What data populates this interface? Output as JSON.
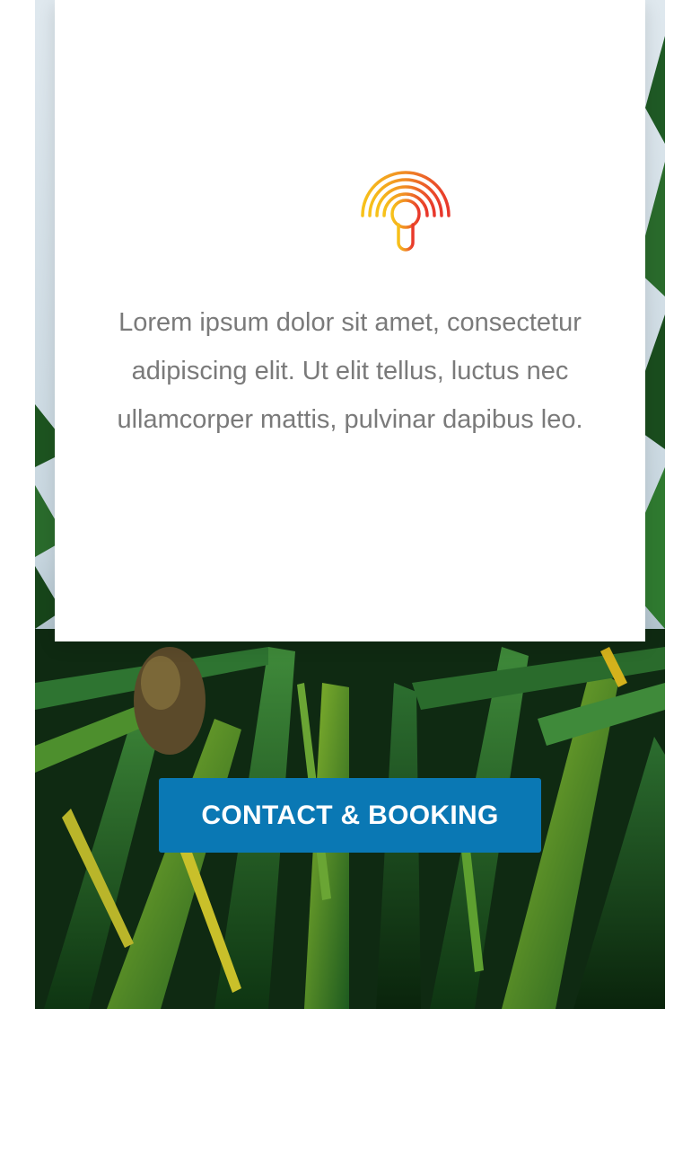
{
  "card": {
    "icon": "signal-pin-icon",
    "text_lines": [
      "Lorem ipsum dolor sit amet, consectetur",
      "adipiscing elit. Ut elit tellus, luctus nec",
      "ullamcorper mattis, pulvinar dapibus leo."
    ]
  },
  "cta": {
    "label": "CONTACT & BOOKING"
  },
  "colors": {
    "accent": "#0a78b4",
    "icon_gradient_start": "#f7c21a",
    "icon_gradient_end": "#e8372c",
    "body_text": "#7a7a7a"
  },
  "background": {
    "image": "palm-leaves-photo"
  }
}
